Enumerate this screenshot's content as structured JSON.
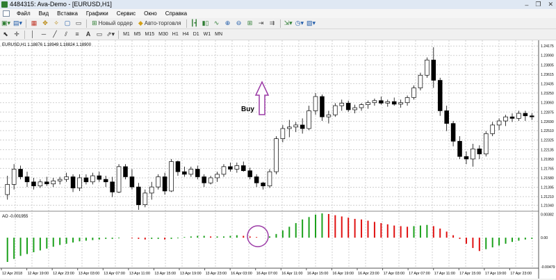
{
  "window": {
    "title": "4484315: Ava-Demo - [EURUSD,H1]",
    "minimize": "–",
    "restore": "❐",
    "close": "✕"
  },
  "menu": [
    "Файл",
    "Вид",
    "Вставка",
    "Графики",
    "Сервис",
    "Окно",
    "Справка"
  ],
  "toolbar": {
    "new_order": "Новый ордер",
    "auto_trading": "Авто-торговля"
  },
  "timeframes": [
    "M1",
    "M5",
    "M15",
    "M30",
    "H1",
    "H4",
    "D1",
    "W1",
    "MN"
  ],
  "chart_header": "EURUSD,H1  1.18876 1.18949 1.18824 1.18900",
  "annotation": {
    "buy": "Buy"
  },
  "indicator": {
    "label": "AO -0.001955"
  },
  "colors": {
    "bull": "#ffffff",
    "bear": "#000000",
    "ao_up": "#1aa01a",
    "ao_down": "#e01010",
    "arrow": "#9b3aa6",
    "circle": "#9b3aa6"
  },
  "chart_data": {
    "type": "candlestick",
    "symbol": "EURUSD",
    "timeframe": "H1",
    "price_ticks": [
      "1.24175",
      "1.23990",
      "1.23805",
      "1.23615",
      "1.23435",
      "1.23250",
      "1.23060",
      "1.22875",
      "1.22690",
      "1.22510",
      "1.22325",
      "1.22135",
      "1.21950",
      "1.21765",
      "1.21580",
      "1.21395",
      "1.21210",
      "1.21040"
    ],
    "ylim": [
      1.2095,
      1.2426
    ],
    "x_labels": [
      "12 Apr 2018",
      "12 Apr 19:00",
      "12 Apr 23:00",
      "13 Apr 03:00",
      "13 Apr 07:00",
      "13 Apr 11:00",
      "13 Apr 15:00",
      "13 Apr 19:00",
      "13 Apr 23:00",
      "16 Apr 03:00",
      "16 Apr 07:00",
      "16 Apr 11:00",
      "16 Apr 15:00",
      "16 Apr 19:00",
      "16 Apr 23:00",
      "17 Apr 03:00",
      "17 Apr 07:00",
      "17 Apr 11:00",
      "17 Apr 15:00",
      "17 Apr 19:00",
      "17 Apr 23:00"
    ],
    "candles": [
      [
        1.2125,
        1.2162,
        1.2115,
        1.2145
      ],
      [
        1.2145,
        1.2185,
        1.2135,
        1.2175
      ],
      [
        1.2175,
        1.2182,
        1.2155,
        1.216
      ],
      [
        1.216,
        1.217,
        1.214,
        1.215
      ],
      [
        1.215,
        1.2158,
        1.2135,
        1.2142
      ],
      [
        1.2142,
        1.2155,
        1.2138,
        1.215
      ],
      [
        1.215,
        1.216,
        1.2142,
        1.2146
      ],
      [
        1.2146,
        1.2158,
        1.214,
        1.2152
      ],
      [
        1.2152,
        1.216,
        1.2145,
        1.2155
      ],
      [
        1.2155,
        1.2168,
        1.215,
        1.216
      ],
      [
        1.216,
        1.2165,
        1.213,
        1.2138
      ],
      [
        1.2138,
        1.2165,
        1.2132,
        1.2158
      ],
      [
        1.2158,
        1.2165,
        1.2145,
        1.215
      ],
      [
        1.215,
        1.2168,
        1.2145,
        1.2162
      ],
      [
        1.2162,
        1.217,
        1.215,
        1.2155
      ],
      [
        1.2155,
        1.2162,
        1.214,
        1.215
      ],
      [
        1.215,
        1.216,
        1.212,
        1.213
      ],
      [
        1.213,
        1.2185,
        1.2128,
        1.218
      ],
      [
        1.218,
        1.2185,
        1.2155,
        1.216
      ],
      [
        1.216,
        1.2175,
        1.2135,
        1.214
      ],
      [
        1.214,
        1.2148,
        1.2095,
        1.2105
      ],
      [
        1.2105,
        1.2135,
        1.21,
        1.2128
      ],
      [
        1.2128,
        1.215,
        1.2115,
        1.214
      ],
      [
        1.214,
        1.2165,
        1.2135,
        1.216
      ],
      [
        1.216,
        1.2168,
        1.2125,
        1.2132
      ],
      [
        1.2132,
        1.2195,
        1.213,
        1.219
      ],
      [
        1.219,
        1.2192,
        1.2162,
        1.217
      ],
      [
        1.217,
        1.218,
        1.216,
        1.2165
      ],
      [
        1.2165,
        1.218,
        1.216,
        1.2175
      ],
      [
        1.2175,
        1.2182,
        1.2155,
        1.216
      ],
      [
        1.216,
        1.2165,
        1.214,
        1.2148
      ],
      [
        1.2148,
        1.2162,
        1.2145,
        1.2158
      ],
      [
        1.2158,
        1.217,
        1.215,
        1.2165
      ],
      [
        1.2165,
        1.2185,
        1.216,
        1.218
      ],
      [
        1.218,
        1.2188,
        1.217,
        1.2175
      ],
      [
        1.2175,
        1.2188,
        1.2168,
        1.2182
      ],
      [
        1.2182,
        1.219,
        1.217,
        1.2172
      ],
      [
        1.2172,
        1.2178,
        1.2155,
        1.216
      ],
      [
        1.216,
        1.2165,
        1.214,
        1.2148
      ],
      [
        1.2148,
        1.215,
        1.2135,
        1.2142
      ],
      [
        1.2142,
        1.2175,
        1.2138,
        1.217
      ],
      [
        1.217,
        1.224,
        1.2165,
        1.2235
      ],
      [
        1.2235,
        1.2262,
        1.2228,
        1.2255
      ],
      [
        1.2255,
        1.2272,
        1.2238,
        1.2258
      ],
      [
        1.2258,
        1.2268,
        1.2248,
        1.2262
      ],
      [
        1.2262,
        1.2275,
        1.2245,
        1.2255
      ],
      [
        1.2255,
        1.23,
        1.2252,
        1.229
      ],
      [
        1.229,
        1.2325,
        1.2282,
        1.2318
      ],
      [
        1.2318,
        1.2322,
        1.227,
        1.2278
      ],
      [
        1.2278,
        1.229,
        1.2265,
        1.2282
      ],
      [
        1.2282,
        1.2305,
        1.2278,
        1.23
      ],
      [
        1.23,
        1.2312,
        1.229,
        1.2305
      ],
      [
        1.2305,
        1.231,
        1.2288,
        1.2292
      ],
      [
        1.2292,
        1.2302,
        1.2285,
        1.2296
      ],
      [
        1.2296,
        1.2305,
        1.229,
        1.2302
      ],
      [
        1.2302,
        1.231,
        1.2294,
        1.2306
      ],
      [
        1.2306,
        1.2314,
        1.23,
        1.231
      ],
      [
        1.231,
        1.2318,
        1.2302,
        1.2305
      ],
      [
        1.2305,
        1.2312,
        1.2298,
        1.2308
      ],
      [
        1.2308,
        1.2316,
        1.23,
        1.2303
      ],
      [
        1.2303,
        1.2312,
        1.2296,
        1.2306
      ],
      [
        1.2306,
        1.232,
        1.23,
        1.2316
      ],
      [
        1.2316,
        1.234,
        1.2312,
        1.2335
      ],
      [
        1.2335,
        1.2365,
        1.233,
        1.236
      ],
      [
        1.236,
        1.2395,
        1.2355,
        1.239
      ],
      [
        1.239,
        1.2415,
        1.2335,
        1.235
      ],
      [
        1.235,
        1.2355,
        1.228,
        1.229
      ],
      [
        1.229,
        1.23,
        1.225,
        1.2265
      ],
      [
        1.2265,
        1.227,
        1.222,
        1.223
      ],
      [
        1.223,
        1.224,
        1.2195,
        1.22
      ],
      [
        1.22,
        1.221,
        1.2185,
        1.2195
      ],
      [
        1.2195,
        1.2225,
        1.218,
        1.2215
      ],
      [
        1.2215,
        1.2222,
        1.2195,
        1.2205
      ],
      [
        1.2205,
        1.225,
        1.22,
        1.2245
      ],
      [
        1.2245,
        1.2268,
        1.224,
        1.2262
      ],
      [
        1.2262,
        1.2275,
        1.2252,
        1.227
      ],
      [
        1.227,
        1.2282,
        1.226,
        1.2278
      ],
      [
        1.2278,
        1.2285,
        1.2268,
        1.2275
      ],
      [
        1.2275,
        1.229,
        1.227,
        1.2285
      ],
      [
        1.2285,
        1.229,
        1.227,
        1.228
      ],
      [
        1.228,
        1.2285,
        1.2272,
        1.2278
      ]
    ],
    "ao_ticks": [
      "0.00382",
      "0.00",
      "-0.00479"
    ],
    "ao_ylim": [
      -0.0048,
      0.0039
    ],
    "ao_values": [
      -0.004,
      -0.0035,
      -0.003,
      -0.0027,
      -0.0024,
      -0.0021,
      -0.0018,
      -0.0015,
      -0.0012,
      -0.001,
      -0.0008,
      -0.0006,
      -0.0005,
      -0.0004,
      -0.0003,
      -0.0002,
      -0.0002,
      -0.0001,
      0.0,
      -0.0001,
      -0.0002,
      -0.0003,
      -0.0002,
      -0.0002,
      -0.0003,
      -0.0002,
      -0.0001,
      0.0001,
      0.0002,
      0.0003,
      0.0003,
      0.0002,
      0.0002,
      0.0002,
      0.0003,
      0.0004,
      0.0003,
      0.0002,
      0.0001,
      0.0,
      0.0002,
      0.0006,
      0.0012,
      0.0018,
      0.0024,
      0.003,
      0.0034,
      0.0038,
      0.004,
      0.0039,
      0.0037,
      0.0035,
      0.0033,
      0.0031,
      0.003,
      0.0028,
      0.0026,
      0.0024,
      0.0022,
      0.002,
      0.0019,
      0.0018,
      0.0019,
      0.002,
      0.0021,
      0.0019,
      0.0015,
      0.001,
      0.0004,
      -0.0002,
      -0.001,
      -0.0017,
      -0.0022,
      -0.0019,
      -0.0016,
      -0.0013,
      -0.001,
      -0.0007,
      -0.0005,
      -0.0003,
      -0.0002
    ]
  }
}
